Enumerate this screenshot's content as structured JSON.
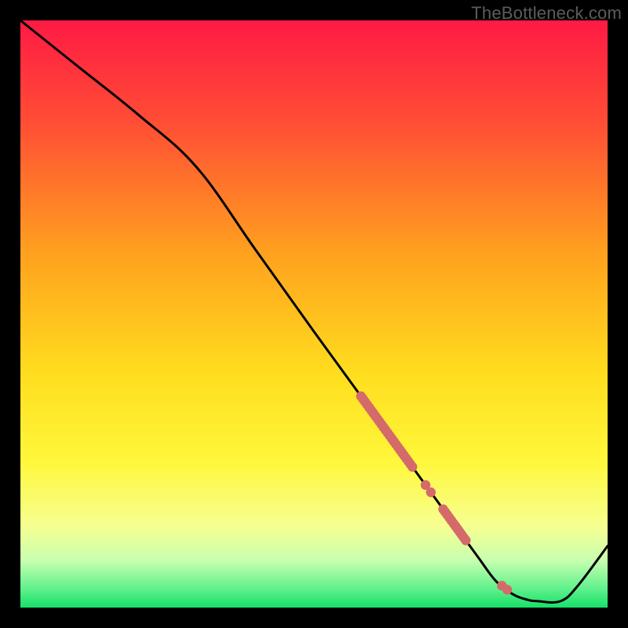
{
  "watermark": "TheBottleneck.com",
  "chart_data": {
    "type": "line",
    "title": "",
    "xlabel": "",
    "ylabel": "",
    "xlim": [
      0,
      100
    ],
    "ylim": [
      0,
      100
    ],
    "series": [
      {
        "name": "curve",
        "x": [
          0,
          10,
          20,
          30,
          40,
          50,
          58,
          62,
          66,
          70,
          74,
          78,
          81,
          84,
          86.5,
          88,
          92,
          95,
          100
        ],
        "y": [
          100,
          92,
          84,
          75,
          61,
          47,
          36,
          30.5,
          25,
          19.5,
          14,
          8.5,
          4.5,
          2.2,
          1.3,
          1.1,
          1.1,
          3.8,
          10.5
        ]
      }
    ],
    "markers": {
      "name": "highlight-dots",
      "color": "#d46a6a",
      "segments": [
        {
          "x_start": 58,
          "x_end": 67,
          "density": "dense"
        },
        {
          "x_start": 69,
          "x_end": 70.5,
          "density": "sparse"
        },
        {
          "x_start": 72,
          "x_end": 76,
          "density": "dense"
        },
        {
          "x_start": 82,
          "x_end": 83,
          "density": "sparse"
        }
      ]
    },
    "background_gradient": {
      "stops": [
        {
          "y": 100,
          "color": "#ff1a44"
        },
        {
          "y": 82,
          "color": "#ff5034"
        },
        {
          "y": 60,
          "color": "#ffa21e"
        },
        {
          "y": 40,
          "color": "#ffdd1e"
        },
        {
          "y": 25,
          "color": "#fff73a"
        },
        {
          "y": 14,
          "color": "#f7ff90"
        },
        {
          "y": 8,
          "color": "#c8ffb0"
        },
        {
          "y": 3,
          "color": "#5df08a"
        },
        {
          "y": 0,
          "color": "#18e06a"
        }
      ]
    }
  }
}
